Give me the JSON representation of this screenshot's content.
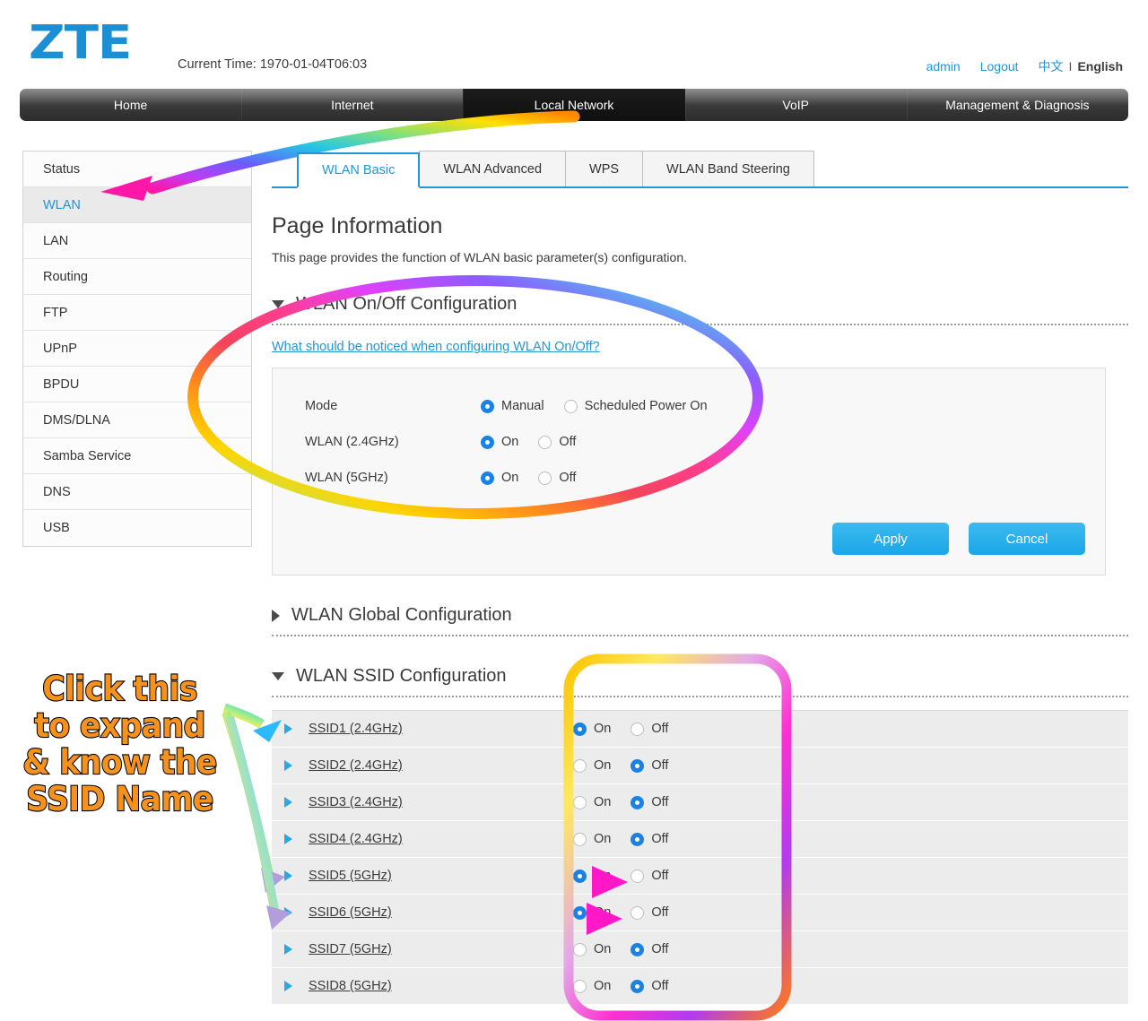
{
  "header": {
    "logo_text": "ZTE",
    "current_time": "Current Time: 1970-01-04T06:03",
    "user": "admin",
    "logout": "Logout",
    "lang_cn": "中文",
    "lang_separator": "I",
    "lang_en": "English"
  },
  "topnav": {
    "items": [
      {
        "label": "Home",
        "active": false
      },
      {
        "label": "Internet",
        "active": false
      },
      {
        "label": "Local Network",
        "active": true
      },
      {
        "label": "VoIP",
        "active": false
      },
      {
        "label": "Management & Diagnosis",
        "active": false
      }
    ]
  },
  "sidebar": {
    "items": [
      {
        "label": "Status",
        "active": false
      },
      {
        "label": "WLAN",
        "active": true
      },
      {
        "label": "LAN",
        "active": false
      },
      {
        "label": "Routing",
        "active": false
      },
      {
        "label": "FTP",
        "active": false
      },
      {
        "label": "UPnP",
        "active": false
      },
      {
        "label": "BPDU",
        "active": false
      },
      {
        "label": "DMS/DLNA",
        "active": false
      },
      {
        "label": "Samba Service",
        "active": false
      },
      {
        "label": "DNS",
        "active": false
      },
      {
        "label": "USB",
        "active": false
      }
    ]
  },
  "tabs": [
    {
      "label": "WLAN Basic",
      "active": true
    },
    {
      "label": "WLAN Advanced",
      "active": false
    },
    {
      "label": "WPS",
      "active": false
    },
    {
      "label": "WLAN Band Steering",
      "active": false
    }
  ],
  "page": {
    "title": "Page Information",
    "description": "This page provides the function of WLAN basic parameter(s) configuration."
  },
  "wlan_onoff": {
    "section_title": "WLAN On/Off Configuration",
    "notice_link": "What should be noticed when configuring WLAN On/Off?",
    "fields": [
      {
        "label": "Mode",
        "options": [
          {
            "label": "Manual",
            "selected": true
          },
          {
            "label": "Scheduled Power On",
            "selected": false
          }
        ]
      },
      {
        "label": "WLAN (2.4GHz)",
        "options": [
          {
            "label": "On",
            "selected": true
          },
          {
            "label": "Off",
            "selected": false
          }
        ]
      },
      {
        "label": "WLAN (5GHz)",
        "options": [
          {
            "label": "On",
            "selected": true
          },
          {
            "label": "Off",
            "selected": false
          }
        ]
      }
    ],
    "apply_label": "Apply",
    "cancel_label": "Cancel"
  },
  "wlan_global": {
    "section_title": "WLAN Global Configuration",
    "expanded": false
  },
  "wlan_ssid": {
    "section_title": "WLAN SSID Configuration",
    "expanded": true,
    "rows": [
      {
        "name": "SSID1 (2.4GHz)",
        "on_label": "On",
        "off_label": "Off",
        "state": "On"
      },
      {
        "name": "SSID2 (2.4GHz)",
        "on_label": "On",
        "off_label": "Off",
        "state": "Off"
      },
      {
        "name": "SSID3 (2.4GHz)",
        "on_label": "On",
        "off_label": "Off",
        "state": "Off"
      },
      {
        "name": "SSID4 (2.4GHz)",
        "on_label": "On",
        "off_label": "Off",
        "state": "Off"
      },
      {
        "name": "SSID5 (5GHz)",
        "on_label": "On",
        "off_label": "Off",
        "state": "On"
      },
      {
        "name": "SSID6 (5GHz)",
        "on_label": "On",
        "off_label": "Off",
        "state": "On"
      },
      {
        "name": "SSID7 (5GHz)",
        "on_label": "On",
        "off_label": "Off",
        "state": "Off"
      },
      {
        "name": "SSID8 (5GHz)",
        "on_label": "On",
        "off_label": "Off",
        "state": "Off"
      }
    ]
  },
  "annotations": {
    "callout_lines": [
      "Click this",
      "to expand",
      "& know the",
      "SSID Name"
    ],
    "callout_color": "#f5921e",
    "callout_outline_color": "#000000"
  },
  "colors": {
    "brand_blue": "#1a8fd4",
    "link_blue": "#2196d6",
    "radio_selected": "#1a82e2",
    "button_blue": "#1aa7e8",
    "nav_dark": "#2d2d2d"
  }
}
